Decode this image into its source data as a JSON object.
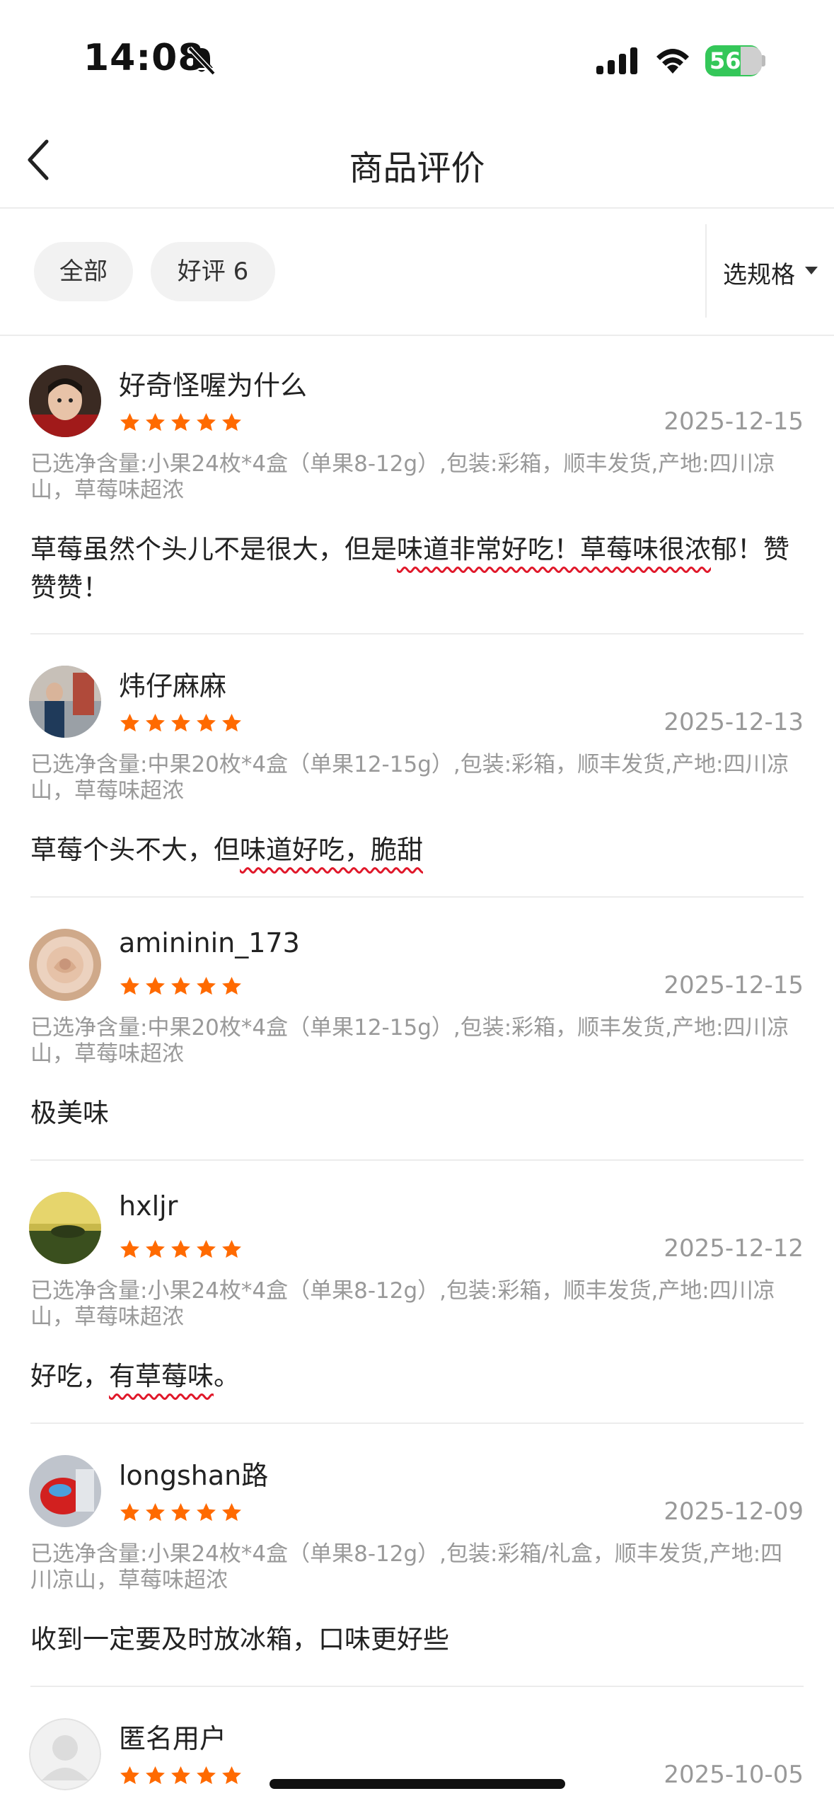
{
  "status": {
    "time": "14:08",
    "battery": "56"
  },
  "nav": {
    "title": "商品评价"
  },
  "filters": {
    "all": "全部",
    "good": "好评 6",
    "spec": "选规格"
  },
  "reviews": [
    {
      "user": "好奇怪喔为什么",
      "date": "2025-12-15",
      "spec": "已选净含量:小果24枚*4盒（单果8-12g）,包装:彩箱，顺丰发货,产地:四川凉山，草莓味超浓",
      "text_before": "草莓虽然个头儿不是很大，但是",
      "text_highlight": "味道非常好吃！草莓味很浓",
      "text_after": "郁！赞赞赞！"
    },
    {
      "user": "炜仔麻麻",
      "date": "2025-12-13",
      "spec": "已选净含量:中果20枚*4盒（单果12-15g）,包装:彩箱，顺丰发货,产地:四川凉山，草莓味超浓",
      "text_before": "草莓个头不大，但",
      "text_highlight": "味道好吃，脆甜",
      "text_after": ""
    },
    {
      "user": "amininin_173",
      "date": "2025-12-15",
      "spec": "已选净含量:中果20枚*4盒（单果12-15g）,包装:彩箱，顺丰发货,产地:四川凉山，草莓味超浓",
      "text_before": "极美味",
      "text_highlight": "",
      "text_after": ""
    },
    {
      "user": "hxljr",
      "date": "2025-12-12",
      "spec": "已选净含量:小果24枚*4盒（单果8-12g）,包装:彩箱，顺丰发货,产地:四川凉山，草莓味超浓",
      "text_before": "好吃，",
      "text_highlight": "有草莓味",
      "text_after": "。"
    },
    {
      "user": "longshan路",
      "date": "2025-12-09",
      "spec": "已选净含量:小果24枚*4盒（单果8-12g）,包装:彩箱/礼盒，顺丰发货,产地:四川凉山，草莓味超浓",
      "text_before": "收到一定要及时放冰箱，口味更好些",
      "text_highlight": "",
      "text_after": ""
    },
    {
      "user": "匿名用户",
      "date": "2025-10-05"
    }
  ],
  "colors": {
    "star": "#ff6a00",
    "underline": "#e0182a",
    "chip_bg": "#f2f2f2"
  },
  "icons": [
    "bell-slash-icon",
    "cellular-signal-icon",
    "wifi-icon",
    "battery-charging-icon",
    "back-chevron-icon",
    "caret-down-icon",
    "star-icon"
  ]
}
